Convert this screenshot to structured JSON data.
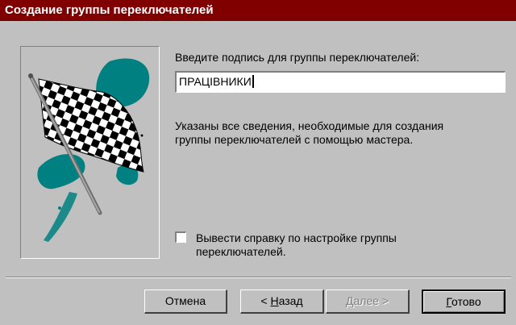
{
  "window": {
    "title": "Создание группы переключателей"
  },
  "prompt": {
    "label": "Введите подпись для группы переключателей:"
  },
  "caption_input": {
    "value": "ПРАЦІВНИКИ"
  },
  "info": {
    "line1": "Указаны все сведения, необходимые для создания",
    "line2": "группы переключателей с помощью мастера."
  },
  "help_checkbox": {
    "checked": false,
    "line1": "Вывести справку по настройке группы",
    "line2": "переключателей."
  },
  "buttons": {
    "cancel": "Отмена",
    "back_prefix": "< ",
    "back_access": "Н",
    "back_rest": "азад",
    "next_access": "Д",
    "next_rest": "алее",
    "next_suffix": " >",
    "finish_access": "Г",
    "finish_rest": "отово"
  },
  "colors": {
    "titlebar": "#800000",
    "splash": "#008080",
    "dialog": "#c0c0c0"
  },
  "illustration": {
    "icon": "checkered-flag-icon"
  }
}
